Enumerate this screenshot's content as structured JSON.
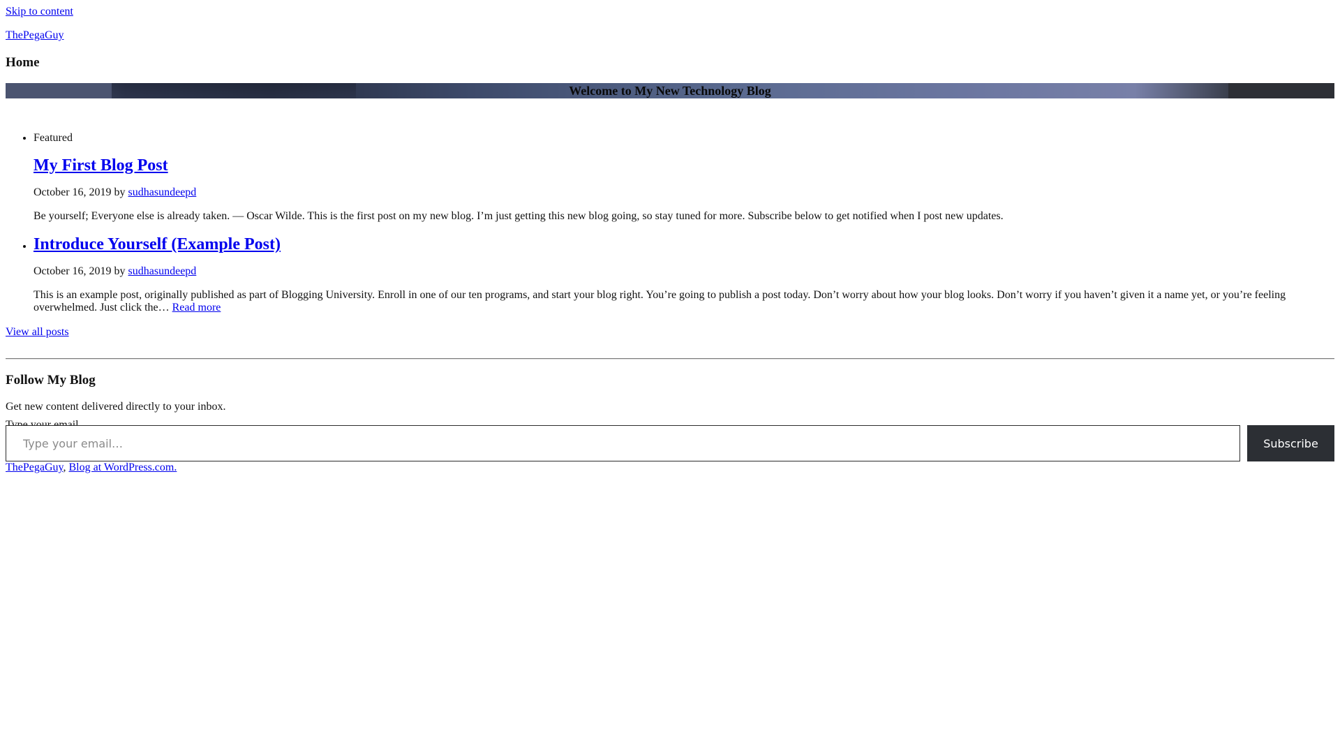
{
  "skip_link": "Skip to content",
  "site": {
    "title": "ThePegaGuy"
  },
  "page": {
    "heading": "Home"
  },
  "hero": {
    "title": "Welcome to My New Technology Blog"
  },
  "posts": [
    {
      "label": "Featured",
      "title": "My First Blog Post",
      "date": "October 16, 2019",
      "by": "by",
      "author": "sudhasundeepd",
      "excerpt": "Be yourself; Everyone else is already taken. — Oscar Wilde. This is the first post on my new blog. I’m just getting this new blog going, so stay tuned for more. Subscribe below to get notified when I post new updates."
    },
    {
      "title": "Introduce Yourself (Example Post)",
      "date": "October 16, 2019",
      "by": "by",
      "author": "sudhasundeepd",
      "excerpt": "This is an example post, originally published as part of Blogging University. Enroll in one of our ten programs, and start your blog right. You’re going to publish a post today. Don’t worry about how your blog looks. Don’t worry if you haven’t given it a name yet, or you’re feeling overwhelmed. Just click the…",
      "read_more": "Read more"
    }
  ],
  "view_all": "View all posts",
  "follow": {
    "heading": "Follow My Blog",
    "description": "Get new content delivered directly to your inbox.",
    "email_label": "Type your email…",
    "email_placeholder": "Type your email…",
    "email_value": "",
    "subscribe_label": "Subscribe"
  },
  "footer": {
    "site_link": "ThePegaGuy",
    "separator": ",",
    "wp_link": "Blog at WordPress.com."
  }
}
